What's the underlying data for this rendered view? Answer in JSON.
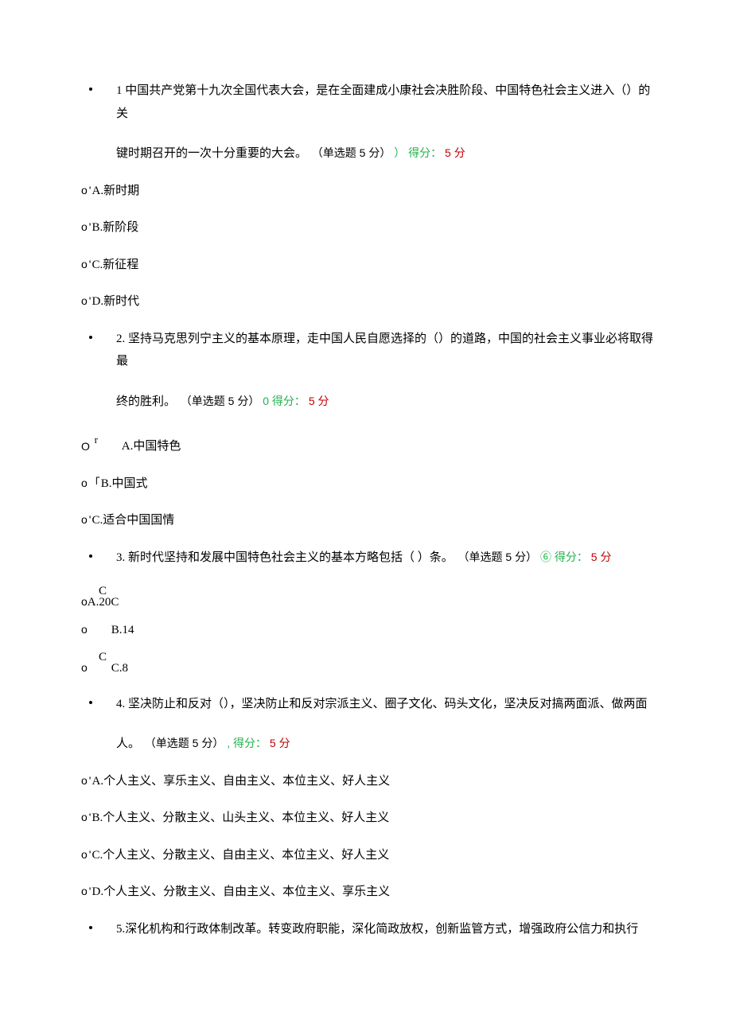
{
  "questions": [
    {
      "num": "1",
      "text": "中国共产党第十九次全国代表大会，是在全面建成小康社会决胜阶段、中国特色社会主义进入（）的关",
      "text2": "键时期召开的一次十分重要的大会。",
      "meta_paren": "（单选题 5 分）",
      "score_sep": "）",
      "score_label": "得分：",
      "score_val": "5 分",
      "options": [
        {
          "o": "o",
          "sym": "ʹ",
          "label": "A.新时期"
        },
        {
          "o": "o",
          "sym": "ʹ",
          "label": "B.新阶段"
        },
        {
          "o": "o",
          "sym": "ʹ",
          "label": "C.新征程"
        },
        {
          "o": "o",
          "sym": "ʹ",
          "label": "D.新时代"
        }
      ]
    },
    {
      "num": "2.",
      "text": "坚持马克思列宁主义的基本原理，走中国人民自愿选择的（）的道路，中国的社会主义事业必将取得最",
      "text2": "终的胜利。",
      "meta_paren": "（单选题 5 分）",
      "score_sep": "0",
      "score_label": "得分：",
      "score_val": "5 分",
      "options_r": {
        "o": "O",
        "r": "r",
        "label": "A.中国特色"
      },
      "options": [
        {
          "o": "o",
          "sym": "「",
          "label": "B.中国式"
        },
        {
          "o": "o",
          "sym": "ʹ",
          "label": "C.适合中国国情"
        }
      ]
    },
    {
      "num": "3.",
      "text": "新时代坚持和发展中国特色社会主义的基本方略包括（ ）条。",
      "meta_paren": "（单选题 5 分）",
      "score_sep": "⑥",
      "score_label": "得分：",
      "score_val": "5 分",
      "option_a": {
        "c": "C",
        "o": "o",
        "label": "A.20C"
      },
      "option_b": {
        "o": "o",
        "label": "B.14"
      },
      "option_c": {
        "c": "C",
        "o": "o",
        "label": "C.8"
      }
    },
    {
      "num": "4.",
      "text": "坚决防止和反对（），坚决防止和反对宗派主义、圈子文化、码头文化，坚决反对搞两面派、做两面",
      "text2": "人。",
      "meta_paren": "（单选题 5 分）",
      "score_sep": ",",
      "score_label": "得分：",
      "score_val": "5 分",
      "options": [
        {
          "o": "o",
          "sym": "ʹ",
          "label": "A.个人主义、享乐主义、自由主义、本位主义、好人主义"
        },
        {
          "o": "o",
          "sym": "ʹ",
          "label": "B.个人主义、分散主义、山头主义、本位主义、好人主义"
        },
        {
          "o": "o",
          "sym": "ʹ",
          "label": "C.个人主义、分散主义、自由主义、本位主义、好人主义"
        },
        {
          "o": "o",
          "sym": "ʹ",
          "label": "D.个人主义、分散主义、自由主义、本位主义、享乐主义"
        }
      ]
    },
    {
      "num": "5.",
      "text": "深化机构和行政体制改革。转变政府职能，深化简政放权，创新监管方式，增强政府公信力和执行"
    }
  ]
}
